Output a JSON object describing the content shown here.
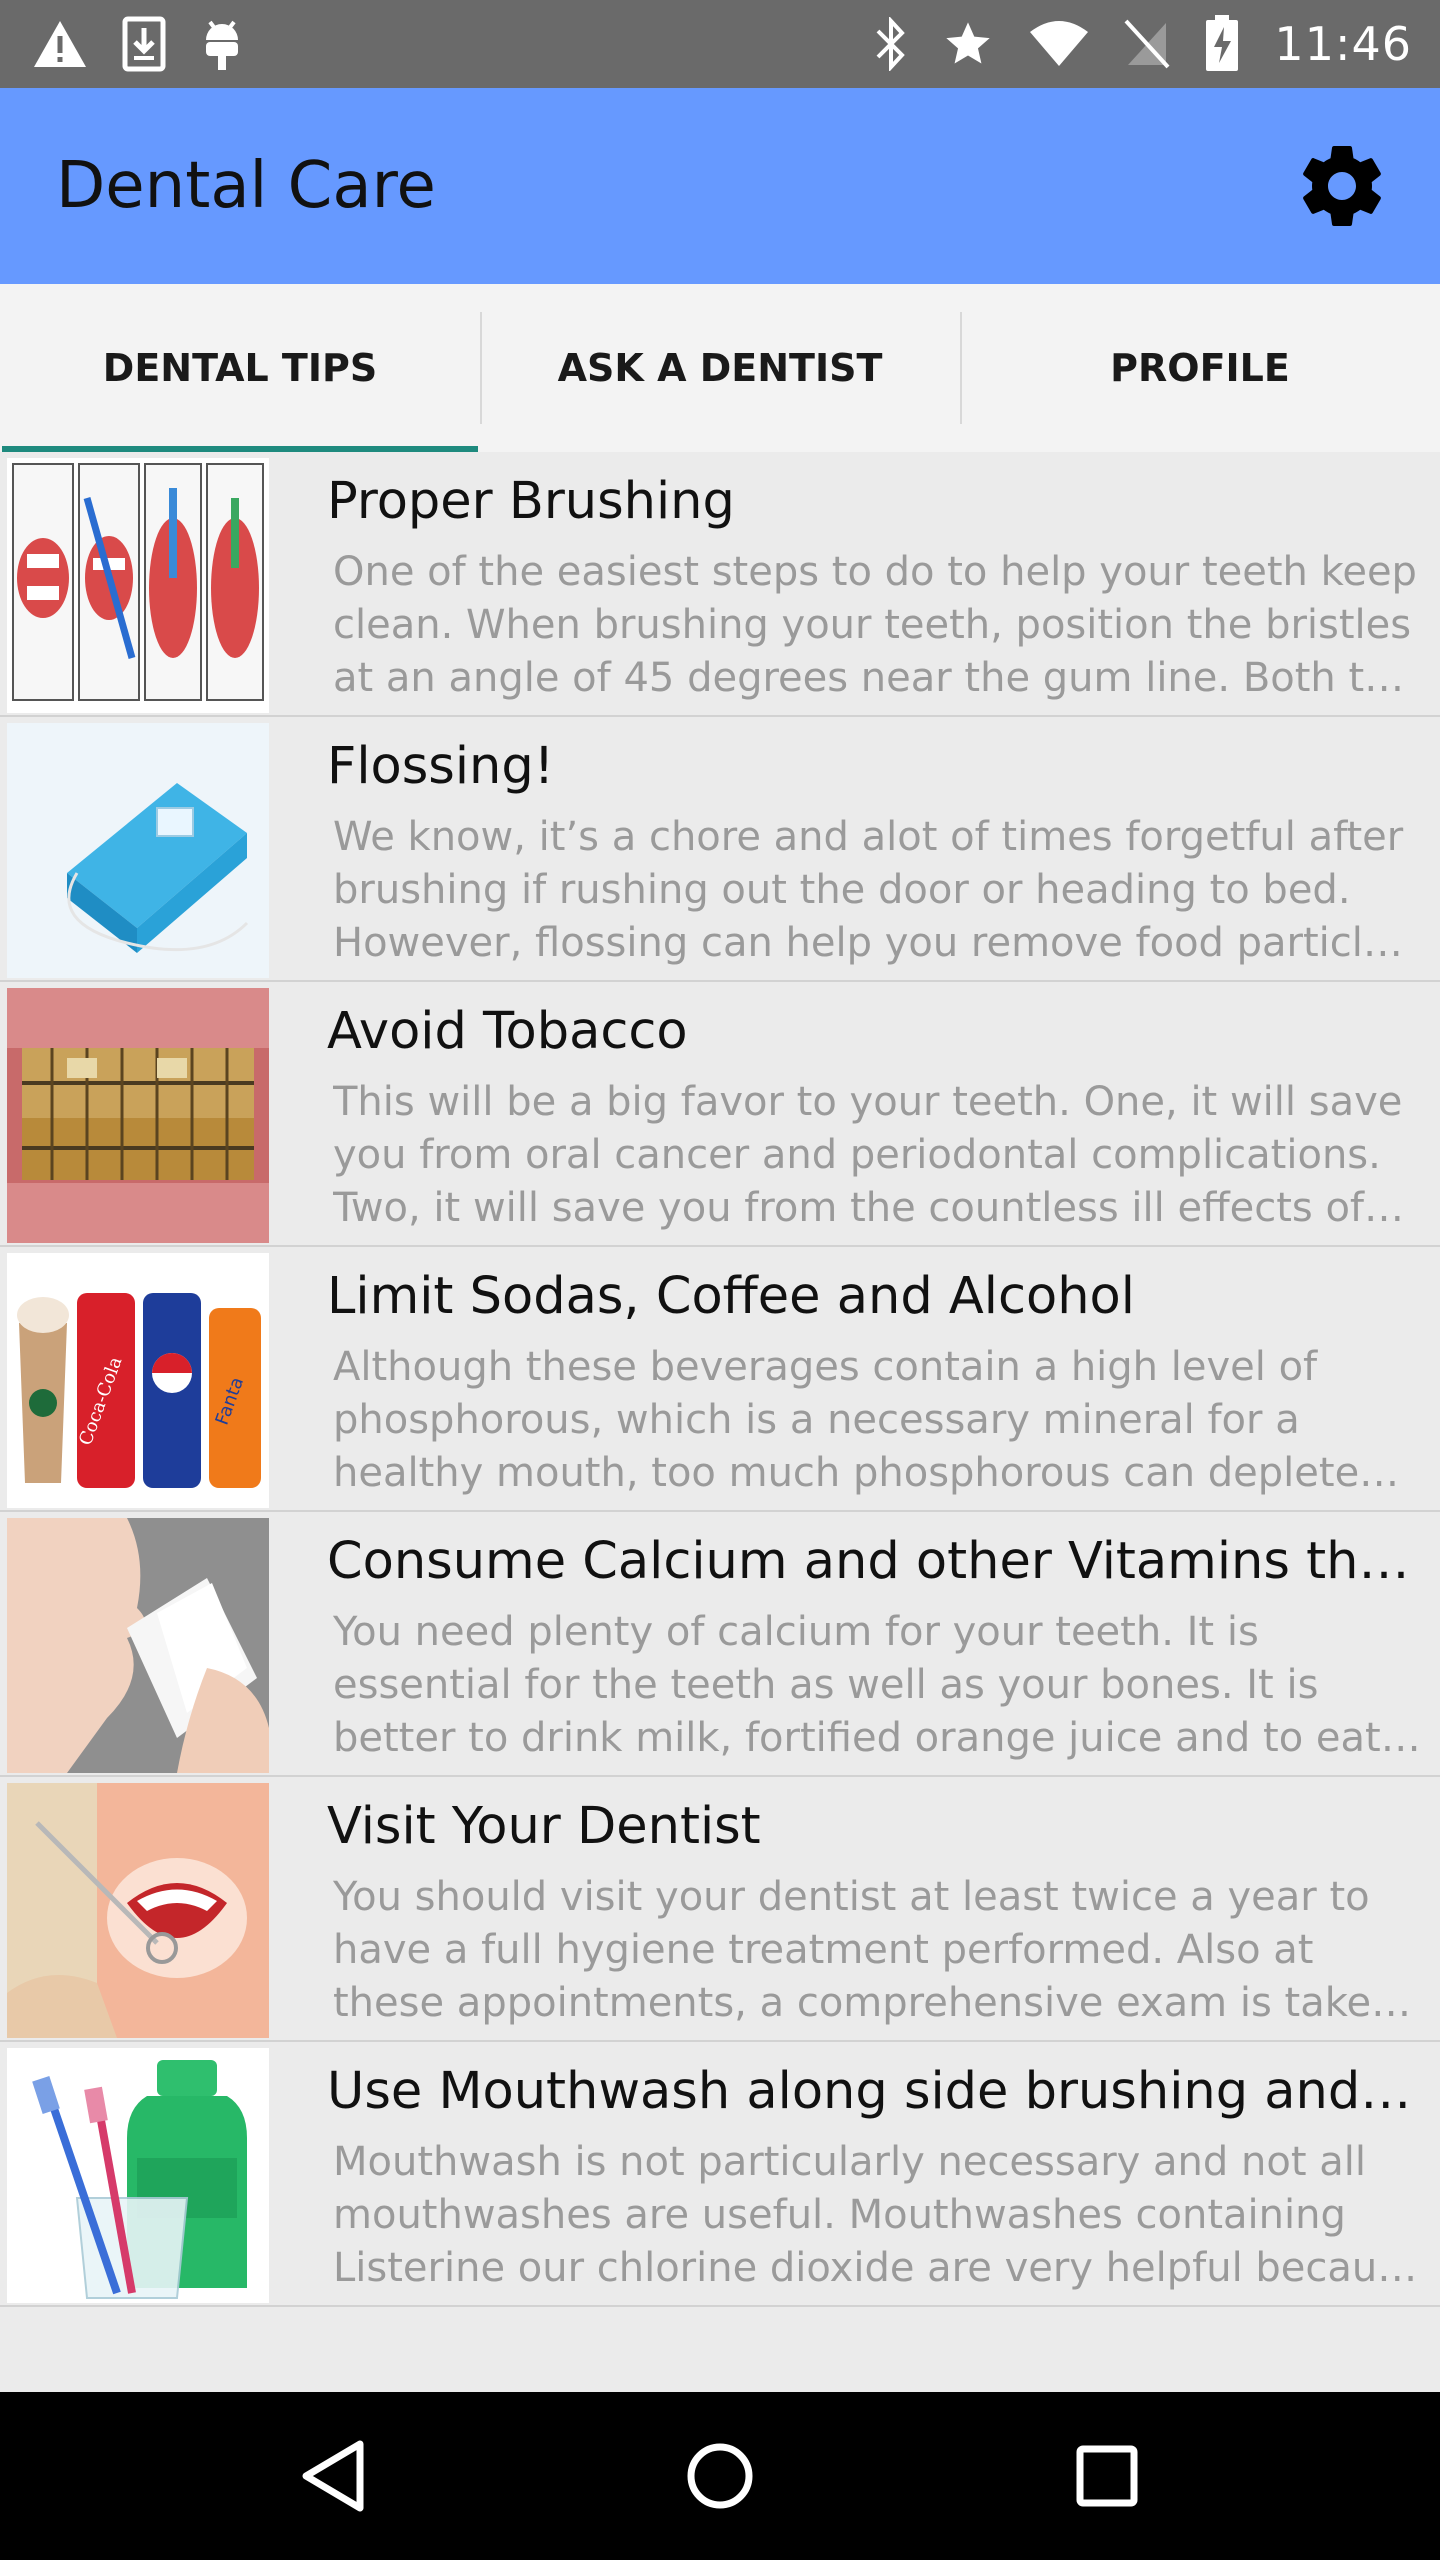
{
  "status_bar": {
    "time": "11:46",
    "left_icons": [
      "warning-icon",
      "download-icon",
      "android-debug-icon"
    ],
    "right_icons": [
      "bluetooth-icon",
      "star-icon",
      "wifi-icon",
      "no-sim-icon",
      "battery-charging-icon"
    ]
  },
  "app_bar": {
    "title": "Dental Care",
    "settings_icon": "gear-icon",
    "background_color": "#6699ff"
  },
  "tabs": [
    {
      "label": "DENTAL TIPS",
      "active": true
    },
    {
      "label": "ASK A DENTIST",
      "active": false
    },
    {
      "label": "PROFILE",
      "active": false
    }
  ],
  "tab_indicator_color": "#1e8a7e",
  "tips": [
    {
      "title": "Proper Brushing",
      "body": "One of the easiest steps to do to help your teeth keep clean. When brushing your teeth, position the bristles at an angle of 45 degrees near the gum line. Both the gum line and the tooth surface should be in contact with the bristles.",
      "image": "brushing-diagram"
    },
    {
      "title": "Flossing!",
      "body": "We know, it’s a chore and alot of times forgetful after brushing if rushing out the door or heading to bed. However, flossing can help you remove food particles stuck between teeth.",
      "image": "dental-floss"
    },
    {
      "title": "Avoid Tobacco",
      "body": "This will be a big favor to your teeth. One, it will save you from oral cancer and periodontal complications. Two, it will save you from the countless ill effects of tobacco on your body.",
      "image": "stained-teeth"
    },
    {
      "title": "Limit Sodas, Coffee and Alcohol",
      "body": "Although these beverages contain a high level of phosphorous, which is a necessary mineral for a healthy mouth, too much phosphorous can deplete the calcium in your body.",
      "image": "beverages"
    },
    {
      "title": "Consume Calcium and other Vitamins that are good for your body",
      "body": "You need plenty of calcium for your teeth. It is essential for the teeth as well as your bones. It is better to drink milk, fortified orange juice and to eat yogurt, cheese and other dairy products.",
      "image": "drinking-milk"
    },
    {
      "title": "Visit Your Dentist",
      "body": "You should visit your dentist at least twice a year to have a full hygiene treatment performed. Also at these appointments, a comprehensive exam is taken with x-rays to check for problems.",
      "image": "dental-exam"
    },
    {
      "title": "Use Mouthwash along side brushing and flossing",
      "body": "Mouthwash is not particularly necessary and not all mouthwashes are useful. Mouthwashes containing Listerine our chlorine dioxide are very helpful because they kill bacteria.",
      "image": "mouthwash"
    }
  ],
  "nav_bar": {
    "icons": [
      "back-icon",
      "home-icon",
      "recents-icon"
    ]
  }
}
